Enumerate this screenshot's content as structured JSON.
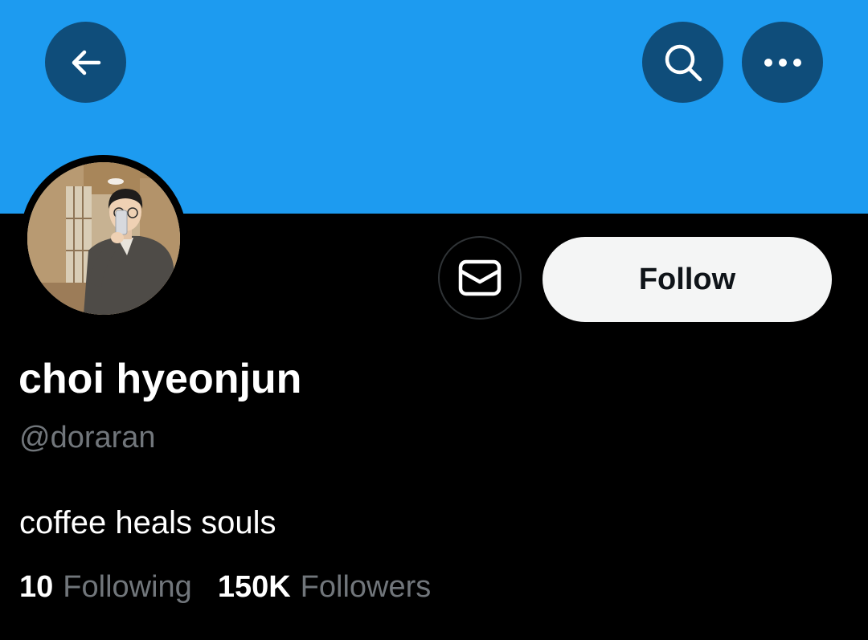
{
  "header": {
    "back_icon": "arrow-left-icon",
    "search_icon": "search-icon",
    "more_icon": "more-horizontal-icon",
    "banner_color": "#1d9bf0",
    "button_bg_color": "#0f4d7a"
  },
  "profile": {
    "display_name": "choi hyeonjun",
    "handle": "@doraran",
    "bio": "coffee heals souls",
    "avatar_icon": "avatar-photo"
  },
  "actions": {
    "message_icon": "envelope-icon",
    "follow_label": "Follow"
  },
  "stats": {
    "following_count": "10",
    "following_label": "Following",
    "followers_count": "150K",
    "followers_label": "Followers"
  }
}
